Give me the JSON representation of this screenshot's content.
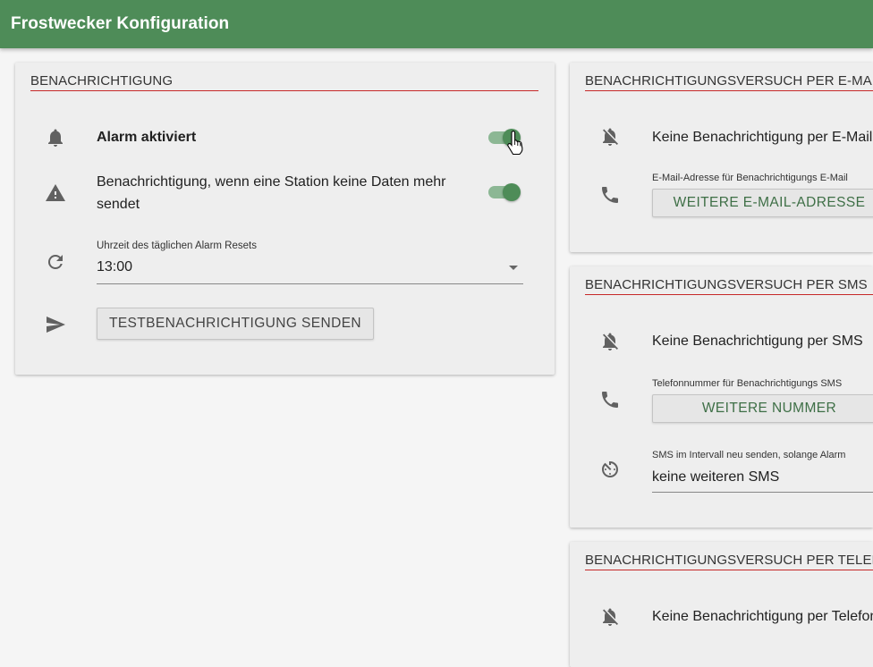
{
  "app": {
    "title": "Frostwecker Konfiguration"
  },
  "notification_card": {
    "header": "BENACHRICHTIGUNG",
    "alarm_label": "Alarm aktiviert",
    "alarm_enabled": true,
    "station_line1": "Benachrichtigung, wenn eine Station keine Daten mehr",
    "station_line2": "sendet",
    "station_enabled": true,
    "reset_label": "Uhrzeit des täglichen Alarm Resets",
    "reset_value": "13:00",
    "test_button": "TESTBENACHRICHTIGUNG SENDEN"
  },
  "email_card": {
    "header": "BENACHRICHTIGUNGSVERSUCH PER E-MAIL",
    "status": "Keine Benachrichtigung per E-Mail",
    "field_label": "E-Mail-Adresse für Benachrichtigungs E-Mail",
    "add_button": "WEITERE E-MAIL-ADRESSE"
  },
  "sms_card": {
    "header": "BENACHRICHTIGUNGSVERSUCH PER SMS",
    "status": "Keine Benachrichtigung per SMS",
    "field_label": "Telefonnummer für Benachrichtigungs SMS",
    "add_button": "WEITERE NUMMER",
    "interval_label": "SMS im Intervall neu senden, solange Alarm",
    "interval_value": "keine weiteren SMS"
  },
  "call_card": {
    "header": "BENACHRICHTIGUNGSVERSUCH PER TELEFON",
    "status": "Keine Benachrichtigung per Telefon"
  },
  "colors": {
    "appbar": "#4e8c58",
    "accent": "#4e8c58",
    "divider": "#c62828"
  },
  "icons": [
    "bell-icon",
    "warning-icon",
    "refresh-icon",
    "send-icon",
    "bell-off-icon",
    "phone-icon",
    "timer-icon"
  ]
}
